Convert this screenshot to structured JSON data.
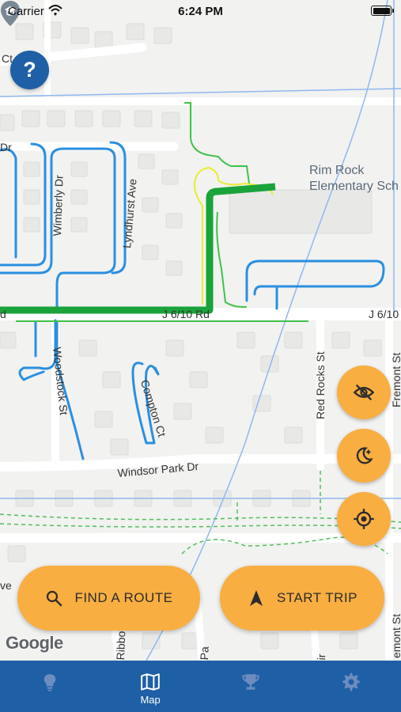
{
  "status_bar": {
    "carrier": "Carrier",
    "time": "6:24 PM"
  },
  "map": {
    "poi": {
      "name_line1": "Rim Rock",
      "name_line2": "Elementary Sch",
      "icon": "school-pin-icon"
    },
    "roads": {
      "top_left_fragment": "Ct",
      "dr_fragment": "Dr",
      "wimberly": "Wimberly Dr",
      "lyndhurst": "Lyndhurst Ave",
      "j610_left_fragment": "d",
      "j610_center": "J 6/10 Rd",
      "j610_right": "J 6/10",
      "woodstock": "Woodstock St",
      "compton": "Compton Ct",
      "red_rocks": "Red Rocks St",
      "fremont_top": "Fremont St",
      "windsor": "Windsor Park Dr",
      "bottom_left_fragment": "ve",
      "ribbon_fragment": "Ribbon",
      "pa_fragment": "Pa",
      "ir_fragment": "ir",
      "fremont_bottom": "emont St"
    },
    "attribution": "Google"
  },
  "help_button": {
    "label": "?"
  },
  "fabs": [
    {
      "icon": "hide-eye-icon"
    },
    {
      "icon": "night-mode-icon"
    },
    {
      "icon": "locate-crosshair-icon"
    }
  ],
  "actions": {
    "find_route": {
      "label": "FIND A ROUTE",
      "icon": "search-icon"
    },
    "start_trip": {
      "label": "START TRIP",
      "icon": "navigation-arrow-icon"
    }
  },
  "tabs": [
    {
      "label": "",
      "icon": "lightbulb-icon"
    },
    {
      "label": "Map",
      "icon": "map-icon"
    },
    {
      "label": "",
      "icon": "trophy-icon"
    },
    {
      "label": "",
      "icon": "gear-icon"
    }
  ],
  "colors": {
    "accent": "#f9ae42",
    "tab_bar": "#1f5fa6",
    "route_primary": "#1aa33a",
    "route_bike": "#2a8fe0",
    "route_yellow": "#f3f33a"
  }
}
